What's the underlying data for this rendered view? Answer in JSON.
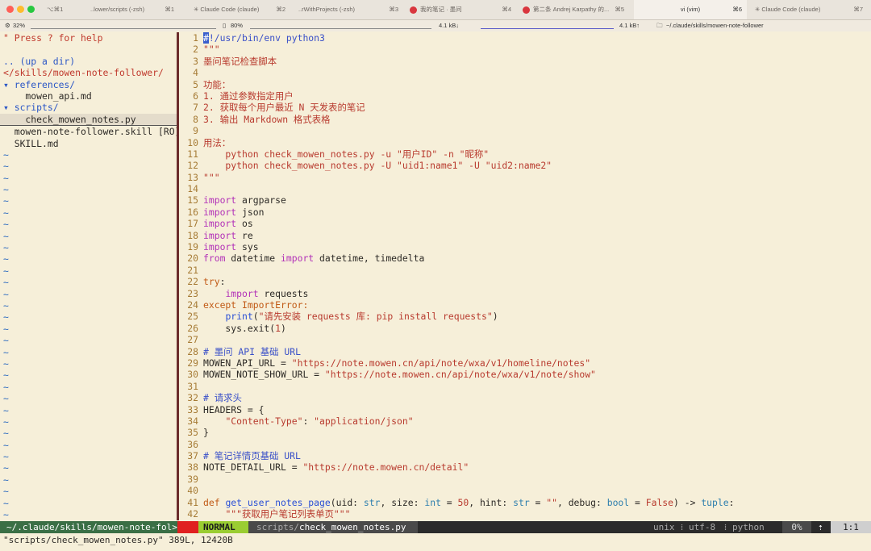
{
  "window": {
    "tabs": [
      {
        "label": "⌥⌘1"
      },
      {
        "label": "..lower/scripts (-zsh)",
        "shortcut": "⌘1"
      },
      {
        "label": "✳ Claude Code (claude)",
        "shortcut": "⌘2"
      },
      {
        "label": "..rWithProjects (-zsh)",
        "shortcut": "⌘3"
      },
      {
        "label": "我的笔记 · 墨问",
        "shortcut": "⌘4"
      },
      {
        "label": "第二条 Andrej Karpathy 的...",
        "shortcut": "⌘5"
      },
      {
        "label": "vi (vim)",
        "shortcut": "⌘6"
      },
      {
        "label": "✳ Claude Code (claude)",
        "shortcut": "⌘7"
      }
    ]
  },
  "strip": {
    "cpu": "32%",
    "mem": "80%",
    "net_down": "4.1 kB↓",
    "net_up": "4.1 kB↑",
    "path": "~/.claude/skills/mowen-note-follower"
  },
  "left_pane": {
    "lines": [
      {
        "text": "\" Press ? for help",
        "cls": "t-help"
      },
      {
        "text": "",
        "cls": "t-plain"
      },
      {
        "text": ".. (up a dir)",
        "cls": "t-dir"
      },
      {
        "text": "</skills/mowen-note-follower/",
        "cls": "t-help"
      },
      {
        "text": "▾ references/",
        "cls": "t-dir"
      },
      {
        "text": "    mowen_api.md",
        "cls": "t-plain"
      },
      {
        "text": "▾ scripts/",
        "cls": "t-dir"
      },
      {
        "text": "    check_mowen_notes.py",
        "cls": "t-plain"
      },
      {
        "text": "  mowen-note-follower.skill [RO]",
        "cls": "t-ro"
      },
      {
        "text": "  SKILL.md",
        "cls": "t-plain"
      }
    ],
    "tilde": "~"
  },
  "code_lines": [
    [
      {
        "t": "#",
        "c": "cursor"
      },
      {
        "t": "!/usr/bin/env python3",
        "c": "t-com"
      }
    ],
    [
      {
        "t": "\"\"\"",
        "c": "t-str"
      }
    ],
    [
      {
        "t": "墨问笔记检查脚本",
        "c": "t-str"
      }
    ],
    [],
    [
      {
        "t": "功能：",
        "c": "t-str"
      }
    ],
    [
      {
        "t": "1. 通过参数指定用户",
        "c": "t-str"
      }
    ],
    [
      {
        "t": "2. 获取每个用户最近 N 天发表的笔记",
        "c": "t-str"
      }
    ],
    [
      {
        "t": "3. 输出 Markdown 格式表格",
        "c": "t-str"
      }
    ],
    [],
    [
      {
        "t": "用法：",
        "c": "t-str"
      }
    ],
    [
      {
        "t": "    python check_mowen_notes.py -u \"用户ID\" -n \"昵称\"",
        "c": "t-str"
      }
    ],
    [
      {
        "t": "    python check_mowen_notes.py -U \"uid1:name1\" -U \"uid2:name2\"",
        "c": "t-str"
      }
    ],
    [
      {
        "t": "\"\"\"",
        "c": "t-str"
      }
    ],
    [],
    [
      {
        "t": "import",
        "c": "t-kw"
      },
      {
        "t": " argparse",
        "c": "t-plain"
      }
    ],
    [
      {
        "t": "import",
        "c": "t-kw"
      },
      {
        "t": " json",
        "c": "t-plain"
      }
    ],
    [
      {
        "t": "import",
        "c": "t-kw"
      },
      {
        "t": " os",
        "c": "t-plain"
      }
    ],
    [
      {
        "t": "import",
        "c": "t-kw"
      },
      {
        "t": " re",
        "c": "t-plain"
      }
    ],
    [
      {
        "t": "import",
        "c": "t-kw"
      },
      {
        "t": " sys",
        "c": "t-plain"
      }
    ],
    [
      {
        "t": "from",
        "c": "t-kw"
      },
      {
        "t": " datetime ",
        "c": "t-plain"
      },
      {
        "t": "import",
        "c": "t-kw"
      },
      {
        "t": " datetime, timedelta",
        "c": "t-plain"
      }
    ],
    [],
    [
      {
        "t": "try",
        "c": "t-kw2"
      },
      {
        "t": ":",
        "c": "t-plain"
      }
    ],
    [
      {
        "t": "    ",
        "c": "t-plain"
      },
      {
        "t": "import",
        "c": "t-kw"
      },
      {
        "t": " requests",
        "c": "t-plain"
      }
    ],
    [
      {
        "t": "except",
        "c": "t-kw2"
      },
      {
        "t": " ImportError:",
        "c": "t-kw2"
      }
    ],
    [
      {
        "t": "    ",
        "c": "t-plain"
      },
      {
        "t": "print",
        "c": "t-fn"
      },
      {
        "t": "(",
        "c": "t-plain"
      },
      {
        "t": "\"请先安装 requests 库: pip install requests\"",
        "c": "t-str"
      },
      {
        "t": ")",
        "c": "t-plain"
      }
    ],
    [
      {
        "t": "    sys.exit(",
        "c": "t-plain"
      },
      {
        "t": "1",
        "c": "t-str"
      },
      {
        "t": ")",
        "c": "t-plain"
      }
    ],
    [],
    [
      {
        "t": "# 墨问 API 基础 URL",
        "c": "t-com"
      }
    ],
    [
      {
        "t": "MOWEN_API_URL = ",
        "c": "t-plain"
      },
      {
        "t": "\"https://note.mowen.cn/api/note/wxa/v1/homeline/notes\"",
        "c": "t-str"
      }
    ],
    [
      {
        "t": "MOWEN_NOTE_SHOW_URL = ",
        "c": "t-plain"
      },
      {
        "t": "\"https://note.mowen.cn/api/note/wxa/v1/note/show\"",
        "c": "t-str"
      }
    ],
    [],
    [
      {
        "t": "# 请求头",
        "c": "t-com"
      }
    ],
    [
      {
        "t": "HEADERS = {",
        "c": "t-plain"
      }
    ],
    [
      {
        "t": "    ",
        "c": "t-plain"
      },
      {
        "t": "\"Content-Type\"",
        "c": "t-str"
      },
      {
        "t": ": ",
        "c": "t-plain"
      },
      {
        "t": "\"application/json\"",
        "c": "t-str"
      }
    ],
    [
      {
        "t": "}",
        "c": "t-plain"
      }
    ],
    [],
    [
      {
        "t": "# 笔记详情页基础 URL",
        "c": "t-com"
      }
    ],
    [
      {
        "t": "NOTE_DETAIL_URL = ",
        "c": "t-plain"
      },
      {
        "t": "\"https://note.mowen.cn/detail\"",
        "c": "t-str"
      }
    ],
    [],
    [],
    [
      {
        "t": "def",
        "c": "t-kw2"
      },
      {
        "t": " ",
        "c": "t-plain"
      },
      {
        "t": "get_user_notes_page",
        "c": "t-fn"
      },
      {
        "t": "(uid: ",
        "c": "t-plain"
      },
      {
        "t": "str",
        "c": "t-typ"
      },
      {
        "t": ", size: ",
        "c": "t-plain"
      },
      {
        "t": "int",
        "c": "t-typ"
      },
      {
        "t": " = ",
        "c": "t-plain"
      },
      {
        "t": "50",
        "c": "t-str"
      },
      {
        "t": ", hint: ",
        "c": "t-plain"
      },
      {
        "t": "str",
        "c": "t-typ"
      },
      {
        "t": " = ",
        "c": "t-plain"
      },
      {
        "t": "\"\"",
        "c": "t-str"
      },
      {
        "t": ", debug: ",
        "c": "t-plain"
      },
      {
        "t": "bool",
        "c": "t-typ"
      },
      {
        "t": " = ",
        "c": "t-plain"
      },
      {
        "t": "False",
        "c": "t-str"
      },
      {
        "t": ") -> ",
        "c": "t-plain"
      },
      {
        "t": "tuple",
        "c": "t-typ"
      },
      {
        "t": ":",
        "c": "t-plain"
      }
    ],
    [
      {
        "t": "    ",
        "c": "t-plain"
      },
      {
        "t": "\"\"\"获取用户笔记列表单页\"\"\"",
        "c": "t-str"
      }
    ]
  ],
  "statusline": {
    "path": "~/.claude/skills/mowen-note-fol>",
    "mode": "NORMAL",
    "file_dir": "scripts/",
    "file_name": "check_mowen_notes.py",
    "format": "unix",
    "encoding": "utf-8",
    "filetype": "python",
    "percent": "0%",
    "position": "1:1"
  },
  "cmdline": "\"scripts/check_mowen_notes.py\" 389L, 12420B",
  "colors": {
    "background": "#f6efd9",
    "mode_bg": "#9acd32",
    "accent_red": "#d9363e"
  }
}
